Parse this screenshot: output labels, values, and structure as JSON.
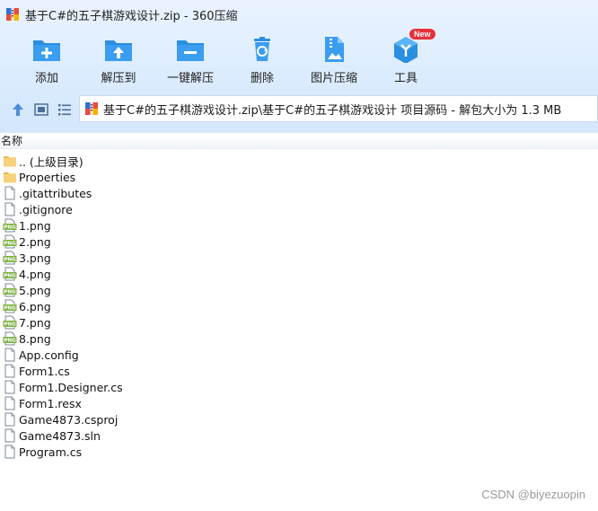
{
  "window": {
    "title": "基于C#的五子棋游戏设计.zip - 360压缩"
  },
  "toolbar": {
    "items": [
      {
        "label": "添加",
        "icon": "add-folder-icon"
      },
      {
        "label": "解压到",
        "icon": "extract-to-icon"
      },
      {
        "label": "一键解压",
        "icon": "one-click-extract-icon"
      },
      {
        "label": "删除",
        "icon": "delete-icon"
      },
      {
        "label": "图片压缩",
        "icon": "image-compress-icon"
      },
      {
        "label": "工具",
        "icon": "tools-icon",
        "badge": "New"
      }
    ]
  },
  "navigation": {
    "path": "基于C#的五子棋游戏设计.zip\\基于C#的五子棋游戏设计 项目源码 - 解包大小为 1.3 MB"
  },
  "file_list": {
    "column_name": "名称",
    "items": [
      {
        "name": ".. (上级目录)",
        "type": "folder-up"
      },
      {
        "name": "Properties",
        "type": "folder"
      },
      {
        "name": ".gitattributes",
        "type": "file"
      },
      {
        "name": ".gitignore",
        "type": "file"
      },
      {
        "name": "1.png",
        "type": "png"
      },
      {
        "name": "2.png",
        "type": "png"
      },
      {
        "name": "3.png",
        "type": "png"
      },
      {
        "name": "4.png",
        "type": "png"
      },
      {
        "name": "5.png",
        "type": "png"
      },
      {
        "name": "6.png",
        "type": "png"
      },
      {
        "name": "7.png",
        "type": "png"
      },
      {
        "name": "8.png",
        "type": "png"
      },
      {
        "name": "App.config",
        "type": "file"
      },
      {
        "name": "Form1.cs",
        "type": "file"
      },
      {
        "name": "Form1.Designer.cs",
        "type": "file"
      },
      {
        "name": "Form1.resx",
        "type": "file"
      },
      {
        "name": "Game4873.csproj",
        "type": "file"
      },
      {
        "name": "Game4873.sln",
        "type": "file"
      },
      {
        "name": "Program.cs",
        "type": "file"
      }
    ]
  },
  "watermark": "CSDN @biyezuopin",
  "colors": {
    "accent": "#2b8fe0",
    "badge": "#e8303a",
    "folder": "#f7d27a"
  }
}
